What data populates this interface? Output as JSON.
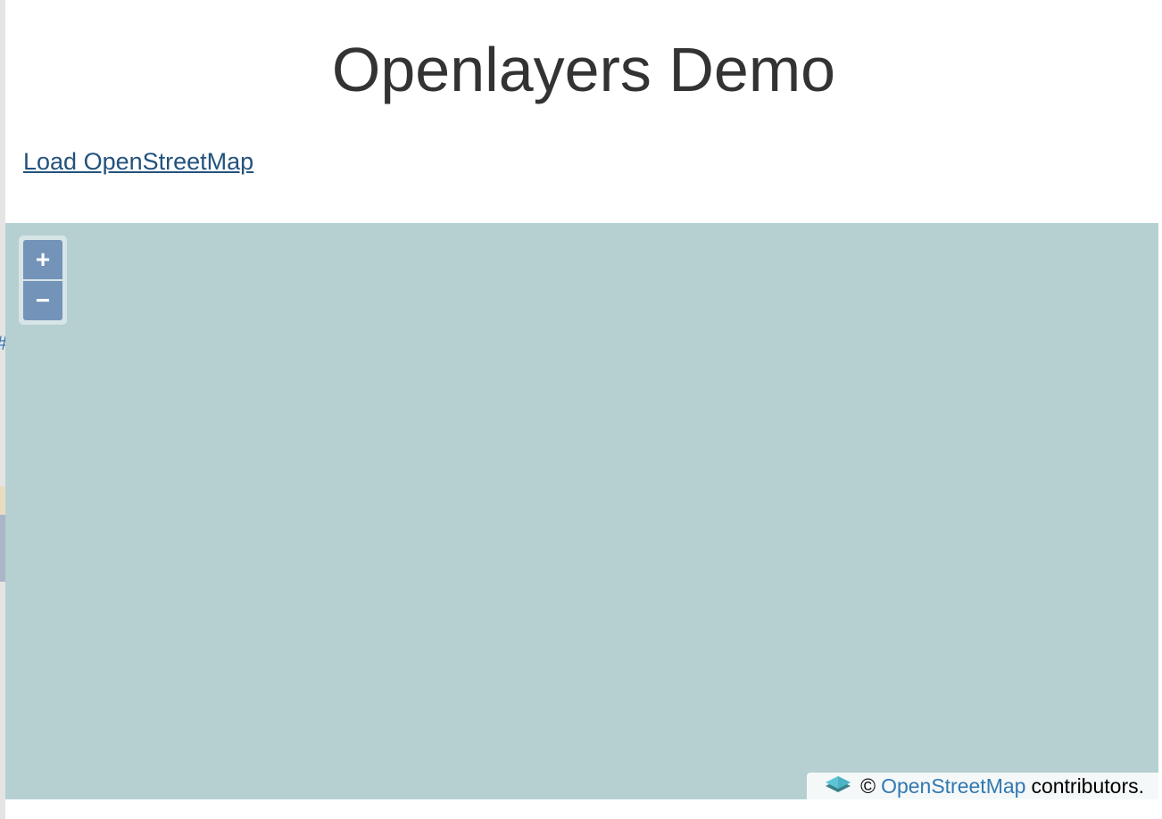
{
  "header": {
    "title": "Openlayers Demo"
  },
  "actions": {
    "load_link": "Load OpenStreetMap"
  },
  "left_edge": {
    "hash_text": "#"
  },
  "map": {
    "background_color": "#b6d0d1",
    "zoom_in_label": "+",
    "zoom_out_label": "−",
    "attribution": {
      "logo_icon": "layers-logo-icon",
      "copyright": "©",
      "link_text": "OpenStreetMap",
      "suffix": "contributors."
    }
  },
  "colors": {
    "link": "#23527c",
    "zoom_button": "#7393b9",
    "attribution_link": "#3378b0"
  }
}
